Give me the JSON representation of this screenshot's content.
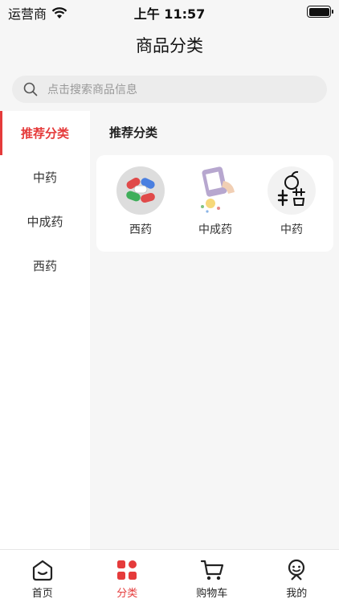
{
  "status_bar": {
    "carrier": "运营商",
    "time": "上午 11:57"
  },
  "header": {
    "title": "商品分类"
  },
  "search": {
    "placeholder": "点击搜索商品信息"
  },
  "sidebar": {
    "items": [
      {
        "label": "推荐分类",
        "active": true
      },
      {
        "label": "中药"
      },
      {
        "label": "中成药"
      },
      {
        "label": "西药"
      }
    ]
  },
  "main": {
    "section_title": "推荐分类",
    "categories": [
      {
        "label": "西药",
        "icon": "pills-icon"
      },
      {
        "label": "中成药",
        "icon": "medicine-bottle-icon"
      },
      {
        "label": "中药",
        "icon": "herbal-medicine-icon"
      }
    ]
  },
  "tabbar": {
    "items": [
      {
        "label": "首页",
        "icon": "home-icon"
      },
      {
        "label": "分类",
        "icon": "category-grid-icon",
        "active": true
      },
      {
        "label": "购物车",
        "icon": "cart-icon"
      },
      {
        "label": "我的",
        "icon": "profile-icon"
      }
    ]
  },
  "colors": {
    "accent": "#e53b3b",
    "background": "#f6f6f6"
  }
}
